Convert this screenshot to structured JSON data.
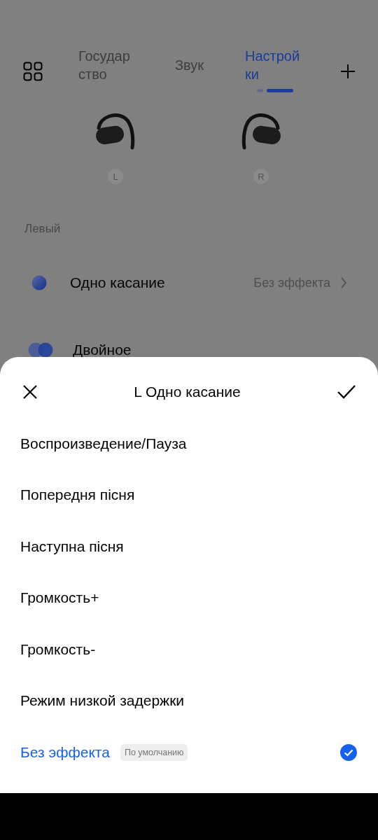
{
  "tabs": [
    {
      "label": "Государ\nство",
      "selected": false
    },
    {
      "label": "Звук",
      "selected": false
    },
    {
      "label": "Настрой\nки",
      "selected": true
    }
  ],
  "earbuds": [
    {
      "side": "L",
      "kind": "left"
    },
    {
      "side": "R",
      "kind": "right"
    }
  ],
  "section_title": "Левый",
  "gestures": [
    {
      "kind": "single",
      "label": "Одно касание",
      "value": "Без эффекта"
    },
    {
      "kind": "double",
      "label": "Двойное"
    }
  ],
  "sheet": {
    "title": "L Одно касание",
    "options": [
      {
        "label": "Воспроизведение/Пауза",
        "selected": false
      },
      {
        "label": "Попередня пісня",
        "selected": false
      },
      {
        "label": "Наступна пісня",
        "selected": false
      },
      {
        "label": "Громкость+",
        "selected": false
      },
      {
        "label": "Громкость-",
        "selected": false
      },
      {
        "label": "Режим низкой задержки",
        "selected": false
      },
      {
        "label": "Без эффекта",
        "selected": true,
        "badge": "По умолчанию"
      }
    ]
  }
}
